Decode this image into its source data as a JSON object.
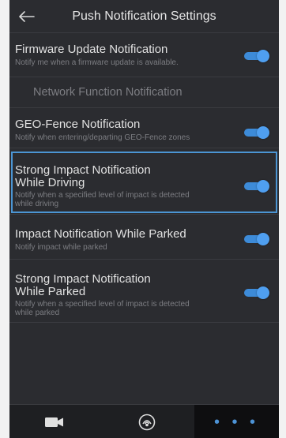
{
  "header": {
    "title": "Push Notification Settings",
    "back_icon": "arrow-left-icon"
  },
  "items": [
    {
      "label": "Firmware Update Notification",
      "desc": "Notify me when a firmware update is available.",
      "enabled": true
    },
    {
      "label": "GEO-Fence Notification",
      "desc": "Notify when entering/departing GEO-Fence zones",
      "enabled": true
    },
    {
      "label_line1": "Strong Impact Notification",
      "label_line2": "While Driving",
      "desc_line1": "Notify when a specified level of impact is detected",
      "desc_line2": "while driving",
      "enabled": true,
      "selected": true
    },
    {
      "label": "Impact Notification While Parked",
      "desc": "Notify impact while parked",
      "enabled": true
    },
    {
      "label_line1": "Strong Impact Notification",
      "label_line2": "While Parked",
      "desc_line1": "Notify when a specified level of impact is detected",
      "desc_line2": "while parked",
      "enabled": true
    }
  ],
  "section": {
    "title": "Network Function Notification"
  },
  "tabbar": {
    "tabs": [
      {
        "icon": "video-camera-icon"
      },
      {
        "icon": "cloud-connect-icon"
      },
      {
        "icon": "more-dots-icon",
        "label": "• • •",
        "active": true
      }
    ]
  },
  "colors": {
    "background": "#2b2c30",
    "accent": "#4f9ff0",
    "selected_outline": "#4b95d3"
  }
}
